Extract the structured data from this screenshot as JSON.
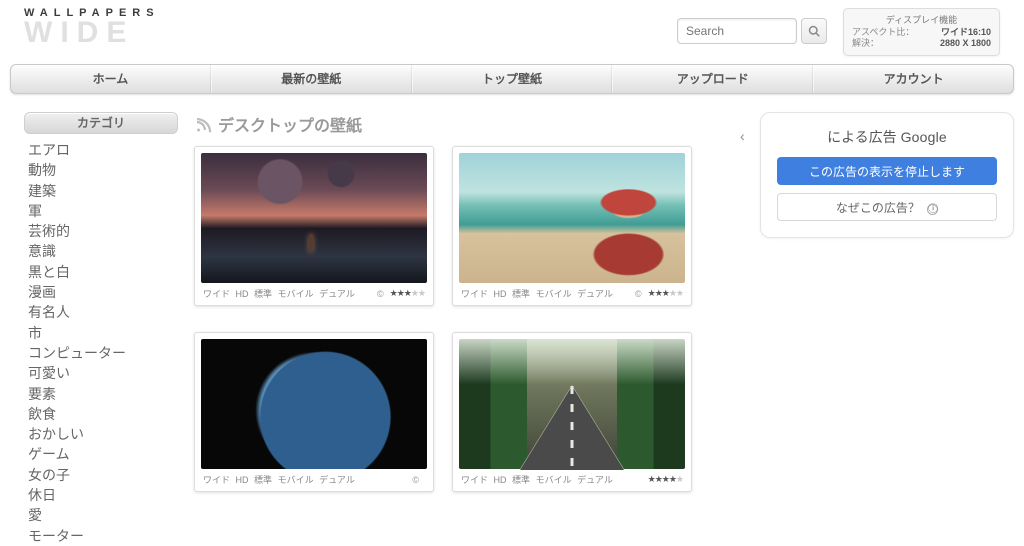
{
  "logo": {
    "top": "WALLPAPERS",
    "bottom": "WIDE"
  },
  "search": {
    "placeholder": "Search"
  },
  "display_box": {
    "header": "ディスプレイ機能",
    "aspect_label": "アスペクト比：",
    "aspect_value": "ワイド16:10",
    "res_label": "解決：",
    "res_value": "2880 X 1800"
  },
  "nav": [
    "ホーム",
    "最新の壁紙",
    "トップ壁紙",
    "アップロード",
    "アカウント"
  ],
  "sidebar": {
    "header": "カテゴリ",
    "items": [
      "エアロ",
      "動物",
      "建築",
      "軍",
      "芸術的",
      "意識",
      "黒と白",
      "漫画",
      "有名人",
      "市",
      "コンピューター",
      "可愛い",
      "要素",
      "飲食",
      "おかしい",
      "ゲーム",
      "女の子",
      "休日",
      "愛",
      "モーター"
    ]
  },
  "main": {
    "title": "デスクトップの壁紙"
  },
  "format_tags": [
    "ワイド",
    "HD",
    "標準",
    "モバイル",
    "デュアル"
  ],
  "copyright_glyph": "©",
  "cards": [
    {
      "rating": 3,
      "has_copyright": true,
      "has_stars": true
    },
    {
      "rating": 3,
      "has_copyright": true,
      "has_stars": true
    },
    {
      "rating": 0,
      "has_copyright": false,
      "has_stars": false
    },
    {
      "rating": 4,
      "has_copyright": false,
      "has_stars": true
    }
  ],
  "ad": {
    "prefix": "による広告",
    "brand": "Google",
    "stop": "この広告の表示を停止します",
    "why": "なぜこの広告？",
    "info": "ⓘ"
  }
}
